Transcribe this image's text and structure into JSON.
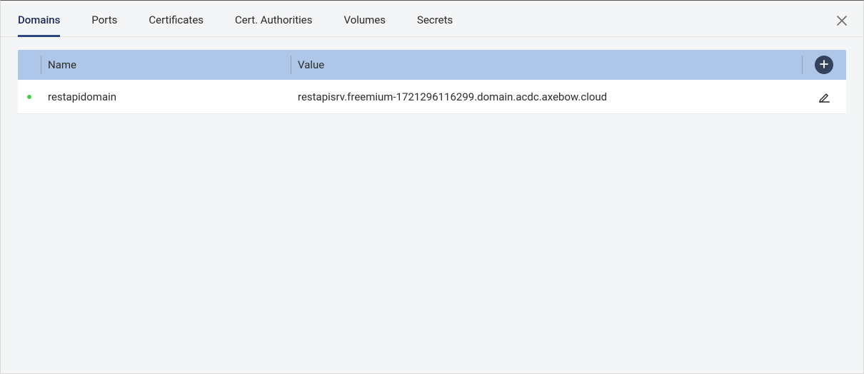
{
  "tabs": {
    "items": [
      {
        "label": "Domains",
        "active": true
      },
      {
        "label": "Ports",
        "active": false
      },
      {
        "label": "Certificates",
        "active": false
      },
      {
        "label": "Cert. Authorities",
        "active": false
      },
      {
        "label": "Volumes",
        "active": false
      },
      {
        "label": "Secrets",
        "active": false
      }
    ]
  },
  "table": {
    "columns": {
      "name": "Name",
      "value": "Value"
    },
    "rows": [
      {
        "status": "active",
        "name": "restapidomain",
        "value": "restapisrv.freemium-1721296116299.domain.acdc.axebow.cloud"
      }
    ]
  },
  "colors": {
    "tab_active": "#2b4882",
    "header_bg": "#aec6e8",
    "status_active": "#4bcf4b",
    "add_button_bg": "#34425b"
  }
}
